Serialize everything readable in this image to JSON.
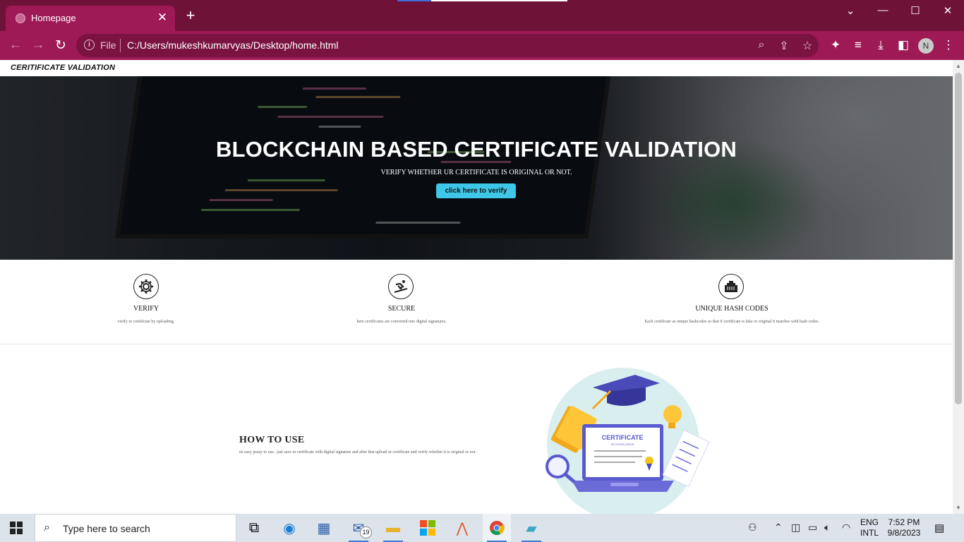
{
  "browser": {
    "tab_title": "Homepage",
    "tab_close": "✕",
    "new_tab": "+",
    "scheme_label": "File",
    "url": "C:/Users/mukeshkumarvyas/Desktop/home.html",
    "profile_initial": "N",
    "theme_color": "#9e1a55"
  },
  "page": {
    "brand": "CERITIFICATE VALIDATION",
    "hero": {
      "title": "BLOCKCHAIN BASED CERTIFICATE VALIDATION",
      "subtitle": "VERIFY WHETHER UR CERTIFICATE IS ORIGINAL OR NOT.",
      "button_label": "click here to verify",
      "button_color": "#3ec7e8"
    },
    "features": [
      {
        "icon": "atom-gear-icon",
        "title": "VERIFY",
        "desc": "verify ur certificate by uploading."
      },
      {
        "icon": "skier-icon",
        "title": "SECURE",
        "desc": "here certificates are converted into digital signatures."
      },
      {
        "icon": "ethernet-port-icon",
        "title": "UNIQUE HASH CODES",
        "desc": "Each certificate as unique hashcodes so that if certificate is fake or original it matches with hash codes."
      }
    ],
    "howto": {
      "title": "HOW TO USE",
      "desc": "its easy peasy to use.. just save ur certificate with digital signature and after that upload ur certificate and verify whether it is original or not.",
      "certificate_title": "CERTIFICATE",
      "certificate_subtitle": "OF EXCELLENCE"
    }
  },
  "taskbar": {
    "search_placeholder": "Type here to search",
    "mail_badge": "19",
    "lang_line1": "ENG",
    "lang_line2": "INTL",
    "time": "7:52 PM",
    "date": "9/8/2023"
  }
}
